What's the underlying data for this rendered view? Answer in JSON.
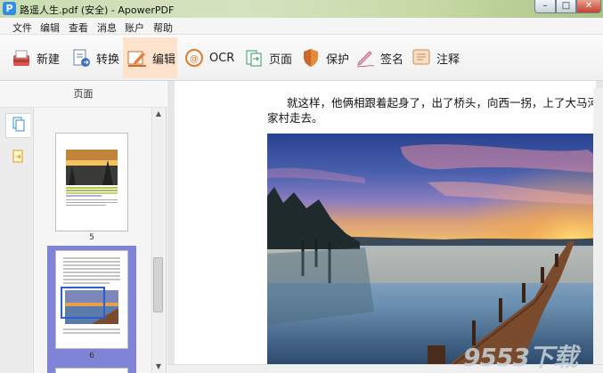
{
  "app": {
    "icon_letter": "P",
    "title": "路遥人生.pdf (安全) - ApowerPDF"
  },
  "window_controls": {
    "minimize": "–",
    "maximize": "□",
    "close": "✕"
  },
  "menu": [
    "文件",
    "编辑",
    "查看",
    "消息",
    "账户",
    "帮助"
  ],
  "toolbar": {
    "active": "编辑",
    "items": [
      {
        "label": "新建",
        "icon": "new-document-icon"
      },
      {
        "label": "转换",
        "icon": "convert-icon"
      },
      {
        "label": "编辑",
        "icon": "edit-icon"
      },
      {
        "label": "OCR",
        "icon": "ocr-icon"
      },
      {
        "label": "页面",
        "icon": "pages-icon"
      },
      {
        "label": "保护",
        "icon": "shield-icon"
      },
      {
        "label": "签名",
        "icon": "signature-icon"
      },
      {
        "label": "注释",
        "icon": "comment-icon"
      }
    ]
  },
  "panel": {
    "title": "页面",
    "tabs": [
      {
        "name": "page-thumbnails-tab",
        "icon": "pages-icon",
        "active": true
      },
      {
        "name": "attachments-tab",
        "icon": "attachment-icon",
        "active": false
      }
    ],
    "thumbnails": [
      {
        "page": "5",
        "selected": false
      },
      {
        "page": "6",
        "selected": true
      }
    ]
  },
  "document": {
    "line1": "就这样，他俩相跟着起身了，出了桥头，向西一拐，上了大马河川道",
    "line2": "家村走去。"
  },
  "watermark": "9553下载",
  "colors": {
    "active_tool_bg": "#fde3cc",
    "selected_thumb": "#7f84d6",
    "accent_red": "#d9534f",
    "accent_blue": "#2f8ee6"
  }
}
